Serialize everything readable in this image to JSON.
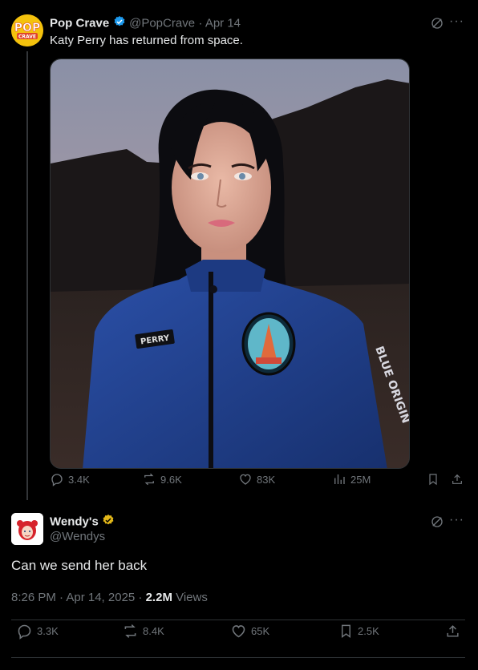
{
  "quoted_tweet": {
    "display_name": "Pop Crave",
    "handle": "@PopCrave",
    "date": "· Apr 14",
    "text": "Katy Perry has returned from space.",
    "avatar_text_top": "POP",
    "avatar_text_bottom": "CRAVE",
    "patch_label": "PERRY",
    "sleeve_text": "BLUE ORIGIN",
    "stats": {
      "replies": "3.4K",
      "reposts": "9.6K",
      "likes": "83K",
      "views": "25M"
    }
  },
  "reply_tweet": {
    "display_name": "Wendy's",
    "handle": "@Wendys",
    "text": "Can we send her back",
    "timestamp": "8:26 PM · Apr 14, 2025 · ",
    "views_count": "2.2M",
    "views_label": " Views",
    "stats": {
      "replies": "3.3K",
      "reposts": "8.4K",
      "likes": "65K",
      "bookmarks": "2.5K"
    }
  },
  "colors": {
    "background": "#000000",
    "text": "#e7e9ea",
    "muted": "#71767b",
    "verified_blue": "#1d9bf0",
    "verified_gold": "#e2b719",
    "suit_blue": "#1f3f8f"
  },
  "icons": [
    "verified-badge-icon",
    "grok-icon",
    "more-icon",
    "reply-icon",
    "repost-icon",
    "like-icon",
    "views-icon",
    "bookmark-icon",
    "share-icon"
  ]
}
